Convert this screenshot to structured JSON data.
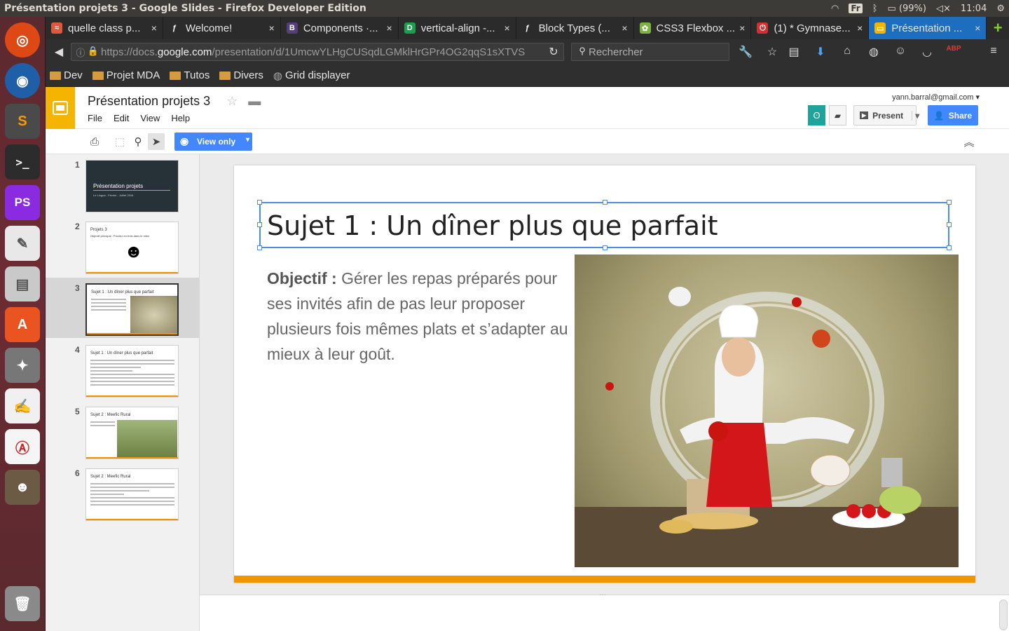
{
  "os": {
    "window_title": "Présentation projets 3 - Google Slides - Firefox Developer Edition",
    "keyboard": "Fr",
    "battery": "(99%)",
    "clock": "11:04"
  },
  "tabs": [
    {
      "label": "quelle class p...",
      "fav_color": "#e0573b",
      "fav_glyph": "≈"
    },
    {
      "label": "Welcome!",
      "fav_color": "#2b2b2b",
      "fav_glyph": "ƒ"
    },
    {
      "label": "Components ·...",
      "fav_color": "#563d7c",
      "fav_glyph": "B"
    },
    {
      "label": "vertical-align -...",
      "fav_color": "#1a9f4a",
      "fav_glyph": "D"
    },
    {
      "label": "Block Types (...",
      "fav_color": "#2b2b2b",
      "fav_glyph": "ƒ"
    },
    {
      "label": "CSS3 Flexbox ...",
      "fav_color": "#7cb342",
      "fav_glyph": "✿"
    },
    {
      "label": "(1) * Gymnase...",
      "fav_color": "#d32f2f",
      "fav_glyph": "⏻"
    },
    {
      "label": "Présentation ...",
      "fav_color": "#f4b400",
      "fav_glyph": "▭"
    }
  ],
  "nav": {
    "url_prefix": "https://docs.",
    "url_host": "google.com",
    "url_rest": "/presentation/d/1UmcwYLHgCUSqdLGMklHrGPr4OG2qqS1sXTVS",
    "search_placeholder": "Rechercher"
  },
  "bookmarks": [
    "Dev",
    "Projet MDA",
    "Tutos",
    "Divers",
    "Grid displayer"
  ],
  "app": {
    "doc_title": "Présentation projets 3",
    "menu": [
      "File",
      "Edit",
      "View",
      "Help"
    ],
    "account": "yann.barral@gmail.com",
    "present_label": "Present",
    "share_label": "Share",
    "view_only_label": "View only"
  },
  "slides": [
    {
      "num": "1",
      "title": "Présentation projets",
      "subtitle": "Le Lingua - Février - Juillet 2016",
      "dark": true
    },
    {
      "num": "2",
      "title": "Projets 3",
      "subtitle": "Objectif principal : Proclez en trois dans le mien",
      "dark": false
    },
    {
      "num": "3",
      "title": "Sujet 1 : Un dîner plus que parfait",
      "subtitle": "",
      "dark": false
    },
    {
      "num": "4",
      "title": "Sujet 1 : Un dîner plus que parfait",
      "subtitle": "",
      "dark": false
    },
    {
      "num": "5",
      "title": "Sujet 2 : Meefic Rural",
      "subtitle": "",
      "dark": false
    },
    {
      "num": "6",
      "title": "Sujet 2 : Meefic Rural",
      "subtitle": "",
      "dark": false
    }
  ],
  "current_slide": {
    "title": "Sujet 1 : Un dîner plus que parfait",
    "objective_label": "Objectif :",
    "objective_text": "Gérer les repas préparés pour ses invités afin de pas leur proposer plusieurs fois mêmes plats et s’adapter au mieux à leur goût."
  },
  "colors": {
    "accent": "#f29400",
    "brand_slides": "#f4b400",
    "selection": "#4a90e2",
    "share": "#4387fd"
  }
}
